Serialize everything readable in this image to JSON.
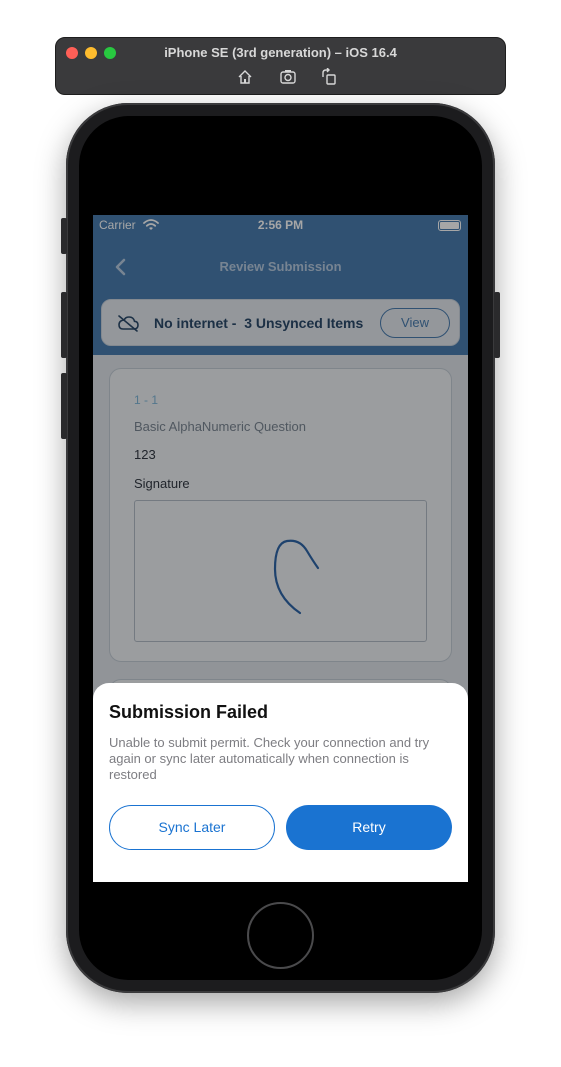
{
  "simulator": {
    "title": "iPhone SE (3rd generation) – iOS 16.4",
    "toolbar_icons": [
      "home-icon",
      "screenshot-icon",
      "rotate-icon"
    ]
  },
  "status_bar": {
    "carrier": "Carrier",
    "time": "2:56 PM",
    "battery_level": 1.0
  },
  "nav": {
    "title": "Review Submission",
    "back_icon": "chevron-left-icon"
  },
  "offline_banner": {
    "icon": "cloud-off-icon",
    "text": "No internet -  3 Unsynced Items",
    "view_label": "View"
  },
  "submission": {
    "question_number": "1 - 1",
    "question_label": "Basic AlphaNumeric Question",
    "answer": "123",
    "signature_label": "Signature"
  },
  "dialog": {
    "title": "Submission Failed",
    "message": "Unable to submit permit. Check your connection and try again or sync later automatically when connection is restored",
    "sync_later_label": "Sync Later",
    "retry_label": "Retry"
  },
  "colors": {
    "header": "#4a7db0",
    "accent": "#1a73d1",
    "overlay": "rgba(0,0,0,0.35)"
  }
}
